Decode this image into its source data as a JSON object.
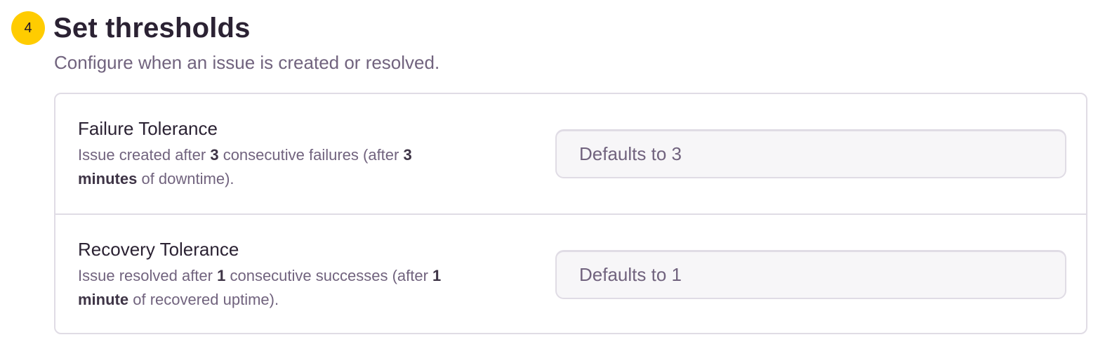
{
  "step": {
    "number": "4",
    "title": "Set thresholds",
    "description": "Configure when an issue is created or resolved."
  },
  "failure": {
    "label": "Failure Tolerance",
    "help_prefix": "Issue created after ",
    "help_count": "3",
    "help_mid": " consecutive failures (after ",
    "help_duration_num": "3",
    "help_duration_unit": "minutes",
    "help_suffix": " of downtime).",
    "placeholder": "Defaults to 3"
  },
  "recovery": {
    "label": "Recovery Tolerance",
    "help_prefix": "Issue resolved after ",
    "help_count": "1",
    "help_mid": " consecutive successes (after ",
    "help_duration_num": "1",
    "help_duration_unit": "minute",
    "help_suffix": " of recovered uptime).",
    "placeholder": "Defaults to 1"
  },
  "colors": {
    "badge": "#ffcc00",
    "text": "#2b2233",
    "muted": "#71637e",
    "border": "#e0dce5"
  }
}
